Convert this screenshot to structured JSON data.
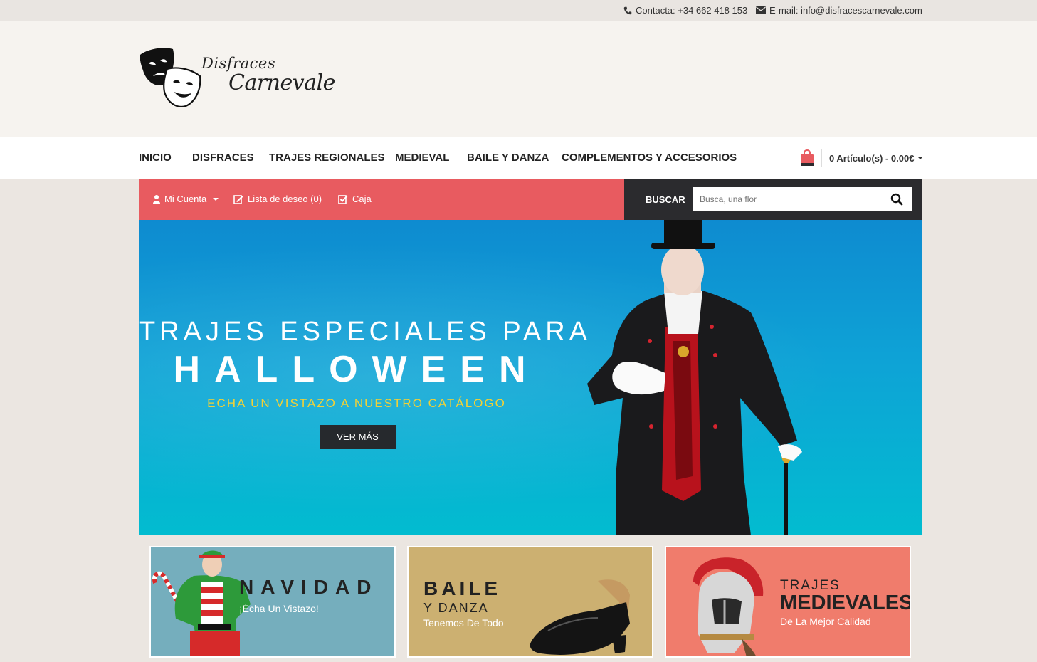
{
  "topbar": {
    "phone": "Contacta: +34 662 418 153",
    "email": "E-mail: info@disfracescarnevale.com"
  },
  "logo": {
    "line1": "Disfraces",
    "line2": "Carnevale"
  },
  "nav": {
    "items": [
      "INICIO",
      "DISFRACES",
      "TRAJES REGIONALES",
      "MEDIEVAL",
      "BAILE Y DANZA",
      "COMPLEMENTOS Y ACCESORIOS"
    ],
    "cart": "0 Artículo(s) - 0.00€"
  },
  "account": {
    "my_account": "Mi Cuenta",
    "wishlist": "Lista de deseo (0)",
    "checkout": "Caja"
  },
  "search": {
    "label": "BUSCAR",
    "placeholder": "Busca, una flor"
  },
  "hero": {
    "line1": "TRAJES ESPECIALES PARA",
    "line2": "HALLOWEEN",
    "line3": "ECHA UN VISTAZO A NUESTRO CATÁLOGO",
    "button": "VER MÁS"
  },
  "promos": [
    {
      "title": "NAVIDAD",
      "subtitle": "¡Échа Un Vistazo!"
    },
    {
      "title": "BAILE",
      "title2": "Y DANZA",
      "subtitle": "Tenemos De Todo"
    },
    {
      "title": "TRAJES",
      "title2": "MEDIEVALES",
      "subtitle": "De La Mejor Calidad"
    }
  ],
  "colors": {
    "accent": "#e85b60",
    "dark": "#2b2b2e",
    "hero_title": "#ffffff",
    "hero_subtitle": "#f3d135"
  }
}
